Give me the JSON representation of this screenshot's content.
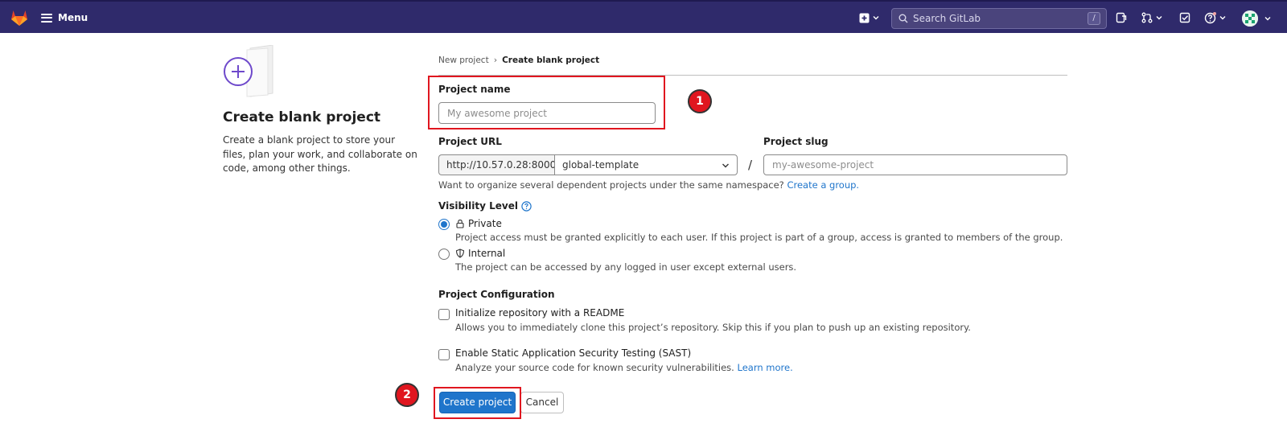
{
  "navbar": {
    "menu_label": "Menu",
    "search_placeholder": "Search GitLab",
    "search_shortcut": "/",
    "icons": [
      "gitlab-logo-icon",
      "menu-icon",
      "new-item-icon",
      "search-icon",
      "issues-icon",
      "merge-requests-icon",
      "todo-icon",
      "help-icon",
      "user-avatar"
    ]
  },
  "left_panel": {
    "title": "Create blank project",
    "description": "Create a blank project to store your files, plan your work, and collaborate on code, among other things."
  },
  "breadcrumb": {
    "parent": "New project",
    "separator": "›",
    "current": "Create blank project"
  },
  "form": {
    "project_name_label": "Project name",
    "project_name_placeholder": "My awesome project",
    "project_url_label": "Project URL",
    "url_prefix": "http://10.57.0.28:8000/",
    "namespace": "global-template",
    "slash": "/",
    "project_slug_label": "Project slug",
    "project_slug_placeholder": "my-awesome-project",
    "namespace_help": "Want to organize several dependent projects under the same namespace?",
    "namespace_help_link": "Create a group.",
    "visibility_label": "Visibility Level",
    "visibility_options": [
      {
        "label": "Private",
        "description": "Project access must be granted explicitly to each user. If this project is part of a group, access is granted to members of the group.",
        "checked": true
      },
      {
        "label": "Internal",
        "description": "The project can be accessed by any logged in user except external users.",
        "checked": false
      }
    ],
    "config_label": "Project Configuration",
    "config_options": [
      {
        "label": "Initialize repository with a README",
        "description": "Allows you to immediately clone this project’s repository. Skip this if you plan to push up an existing repository.",
        "checked": false
      },
      {
        "label": "Enable Static Application Security Testing (SAST)",
        "description": "Analyze your source code for known security vulnerabilities.",
        "link": "Learn more.",
        "checked": false
      }
    ],
    "create_button": "Create project",
    "cancel_button": "Cancel"
  },
  "annotations": {
    "badge_1": "1",
    "badge_2": "2",
    "highlight_color": "#e0161f"
  },
  "colors": {
    "navbar_bg": "#2f2a6b",
    "primary": "#1f75cb",
    "link": "#1f75cb"
  }
}
